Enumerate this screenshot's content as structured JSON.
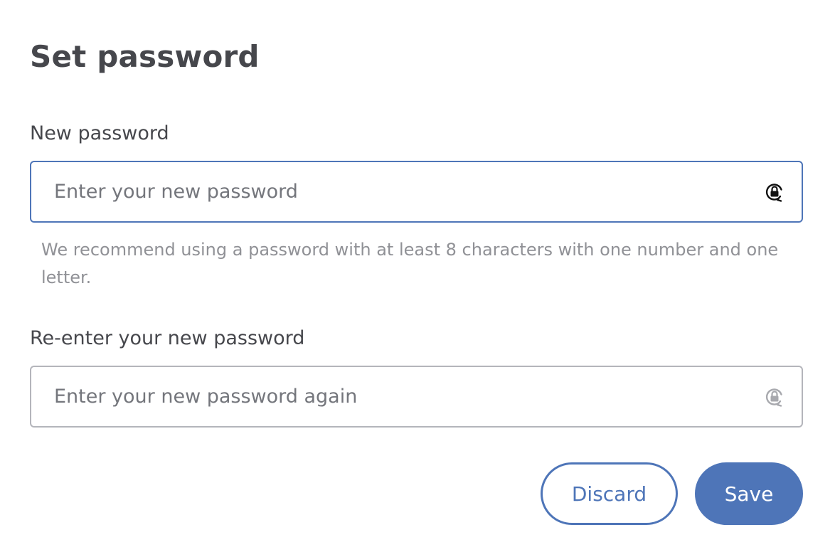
{
  "dialog": {
    "title": "Set password"
  },
  "new_password": {
    "label": "New password",
    "placeholder": "Enter your new password",
    "value": "",
    "icon": "lock-rotate-icon",
    "focused": true,
    "helper": "We recommend using a password with at least 8 characters with one number and one letter."
  },
  "confirm_password": {
    "label": "Re-enter your new password",
    "placeholder": "Enter your new password again",
    "value": "",
    "icon": "lock-rotate-icon",
    "focused": false
  },
  "actions": {
    "discard_label": "Discard",
    "save_label": "Save"
  },
  "colors": {
    "accent": "#4e75b8",
    "title_text": "#46474c",
    "helper_text": "#909196",
    "inactive_border": "#b4b5bb"
  }
}
